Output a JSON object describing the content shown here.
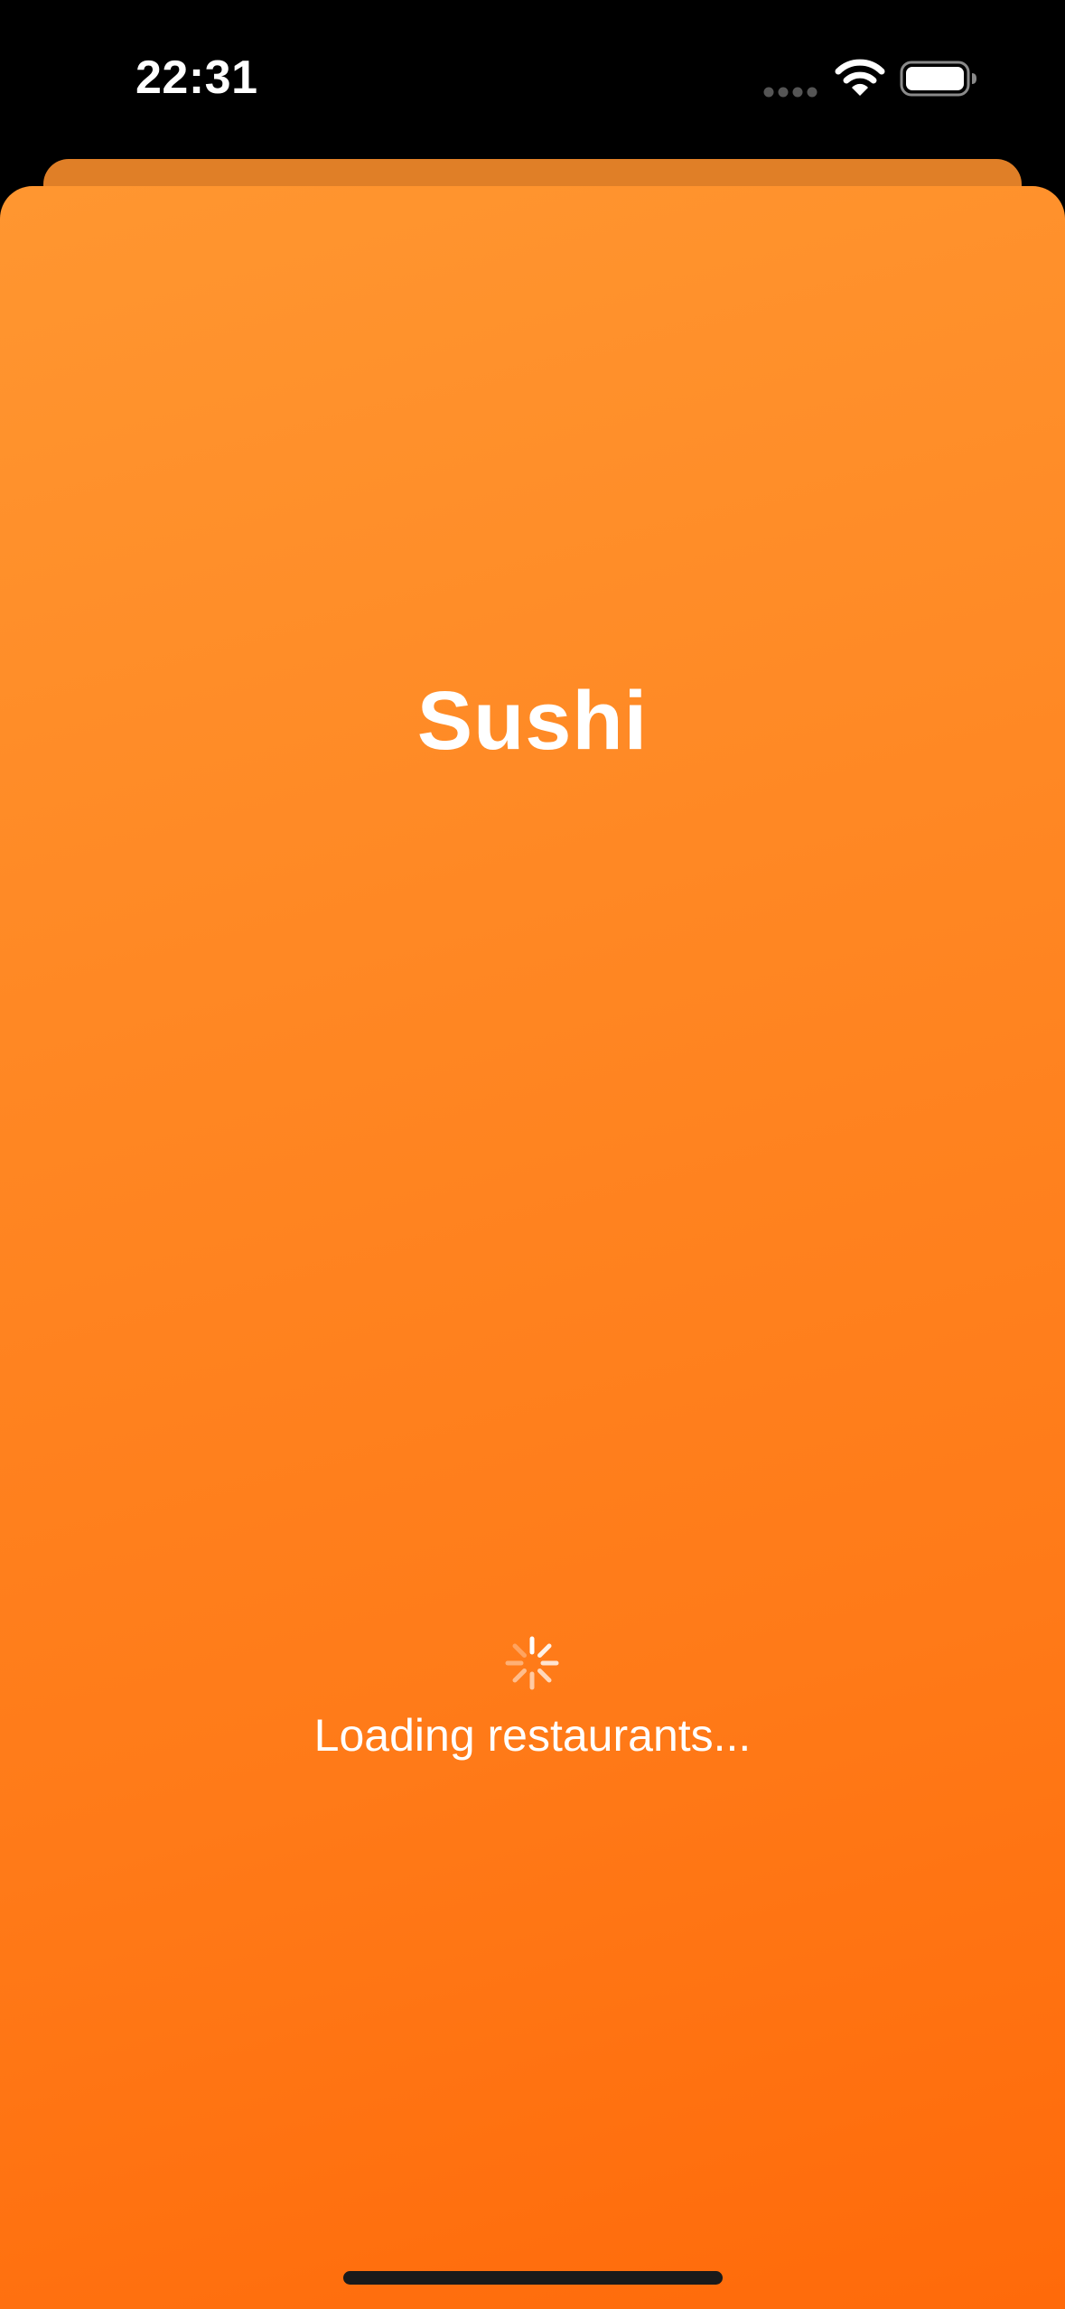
{
  "status_bar": {
    "time": "22:31",
    "signal_icon": "cellular-dots-icon",
    "wifi_icon": "wifi-icon",
    "battery_icon": "battery-icon"
  },
  "screen": {
    "title": "Sushi",
    "loading_icon": "spinner-icon",
    "loading_message": "Loading restaurants..."
  },
  "colors": {
    "background_top": "#ff9630",
    "background_bottom": "#ff6a0a",
    "back_card": "#e07f27",
    "text": "#ffffff"
  }
}
